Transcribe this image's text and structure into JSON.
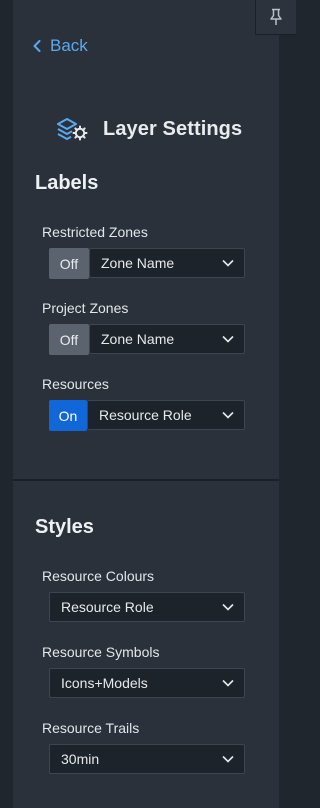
{
  "nav": {
    "back_label": "Back"
  },
  "header": {
    "title": "Layer Settings"
  },
  "labels_section": {
    "title": "Labels",
    "rows": [
      {
        "label": "Restricted Zones",
        "toggle": "Off",
        "select_value": "Zone Name"
      },
      {
        "label": "Project Zones",
        "toggle": "Off",
        "select_value": "Zone Name"
      },
      {
        "label": "Resources",
        "toggle": "On",
        "select_value": "Resource Role"
      }
    ]
  },
  "styles_section": {
    "title": "Styles",
    "rows": [
      {
        "label": "Resource Colours",
        "select_value": "Resource Role"
      },
      {
        "label": "Resource Symbols",
        "select_value": "Icons+Models"
      },
      {
        "label": "Resource Trails",
        "select_value": "30min"
      }
    ]
  },
  "colors": {
    "accent": "#5aa9ee",
    "toggle_on": "#1267d8",
    "toggle_off": "#5b646e",
    "panel": "#2a313a",
    "background": "#20262d"
  },
  "icons": {
    "pin": "pin-icon",
    "back": "chevron-left-icon",
    "layers": "layers-settings-icon",
    "dropdown": "chevron-down-icon"
  }
}
